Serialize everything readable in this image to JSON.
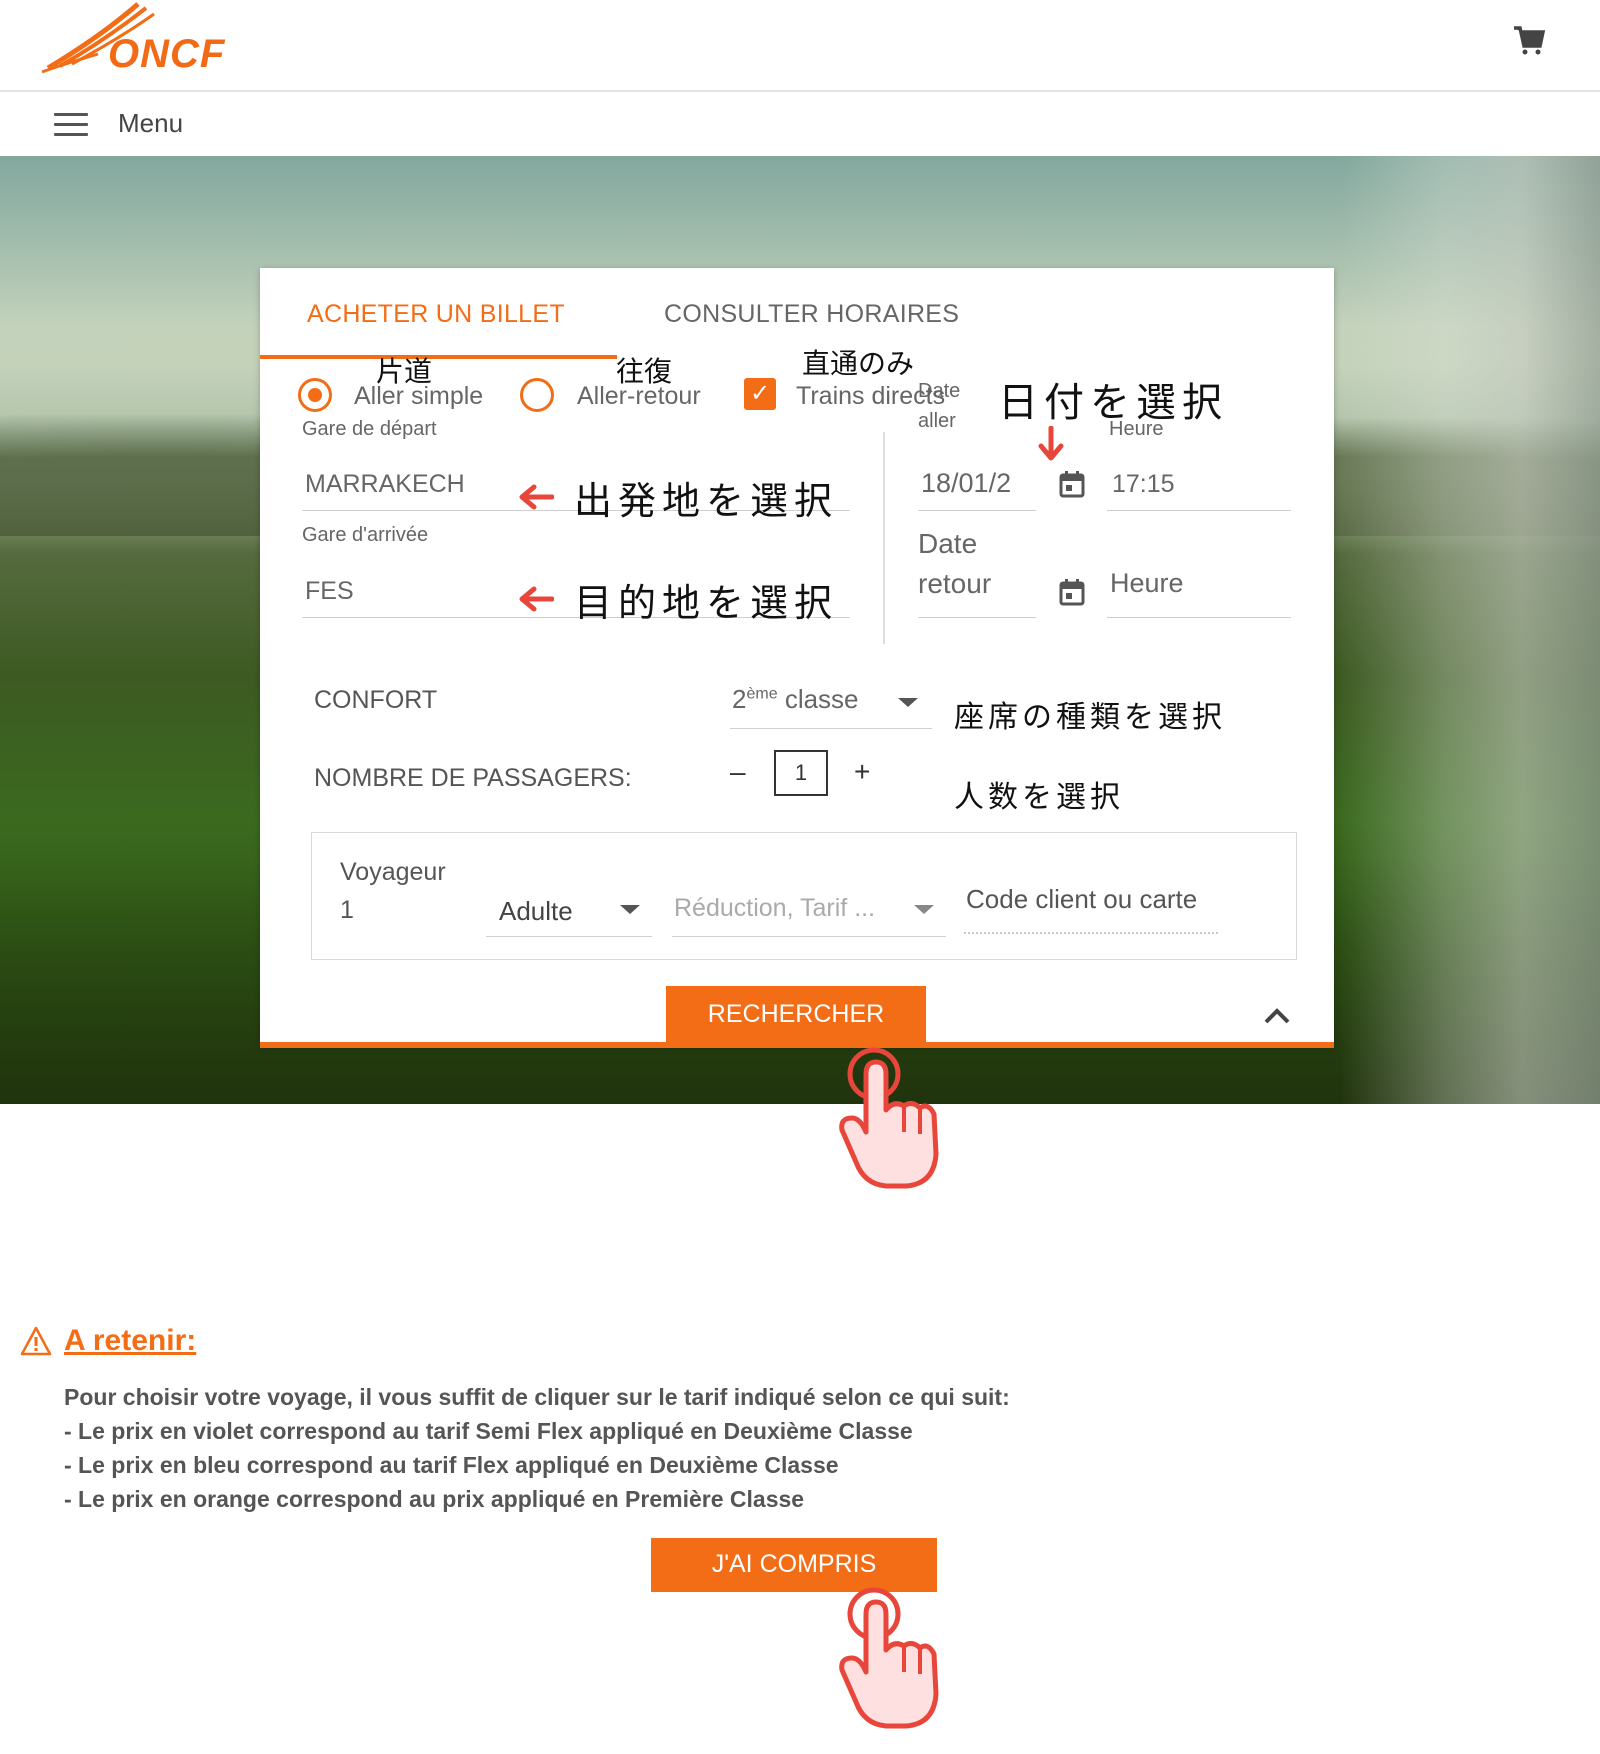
{
  "brand": {
    "logo_text": "ONCF",
    "accent_color": "#f36c16"
  },
  "header": {
    "cart_icon": "shopping-cart-icon",
    "menu_label": "Menu"
  },
  "tabs": [
    {
      "label": "ACHETER UN BILLET",
      "active": true
    },
    {
      "label": "CONSULTER HORAIRES",
      "active": false
    }
  ],
  "trip_type": {
    "one_way": {
      "label": "Aller simple",
      "selected": true,
      "annotation": "片道"
    },
    "round_trip": {
      "label": "Aller-retour",
      "selected": false,
      "annotation": "往復"
    },
    "direct": {
      "label": "Trains directs",
      "checked": true,
      "annotation": "直通のみ"
    }
  },
  "departure": {
    "label": "Gare de départ",
    "value": "MARRAKECH",
    "annotation": "出発地を選択"
  },
  "arrival": {
    "label": "Gare d'arrivée",
    "value": "FES",
    "annotation": "目的地を選択"
  },
  "date_aller": {
    "label_line1": "Date",
    "label_line2": "aller",
    "value": "18/01/2",
    "annotation": "日付を選択"
  },
  "heure_aller": {
    "label": "Heure",
    "value": "17:15"
  },
  "date_retour": {
    "label_line1": "Date",
    "label_line2": "retour"
  },
  "heure_retour": {
    "placeholder": "Heure"
  },
  "confort": {
    "label": "CONFORT",
    "value_sup_prefix": "2",
    "value_sup": "ème",
    "value_suffix": " classe",
    "annotation": "座席の種類を選択"
  },
  "passengers": {
    "label": "NOMBRE DE PASSAGERS:",
    "minus": "–",
    "count": "1",
    "plus": "+",
    "annotation": "人数を選択"
  },
  "traveler": {
    "label": "Voyageur",
    "number": "1",
    "type": "Adulte",
    "reduction_placeholder": "Réduction, Tarif ...",
    "code_placeholder": "Code client ou carte"
  },
  "search_button": "RECHERCHER",
  "notice": {
    "title": "A retenir:",
    "lines": [
      "Pour choisir votre voyage, il vous suffit de cliquer sur le tarif indiqué selon ce qui suit:",
      "- Le prix en violet correspond au tarif Semi Flex appliqué en Deuxième Classe",
      "- Le prix en bleu correspond au tarif Flex appliqué en Deuxième Classe",
      "- Le prix en orange correspond au prix appliqué en Première Classe"
    ],
    "button": "J'AI COMPRIS"
  }
}
